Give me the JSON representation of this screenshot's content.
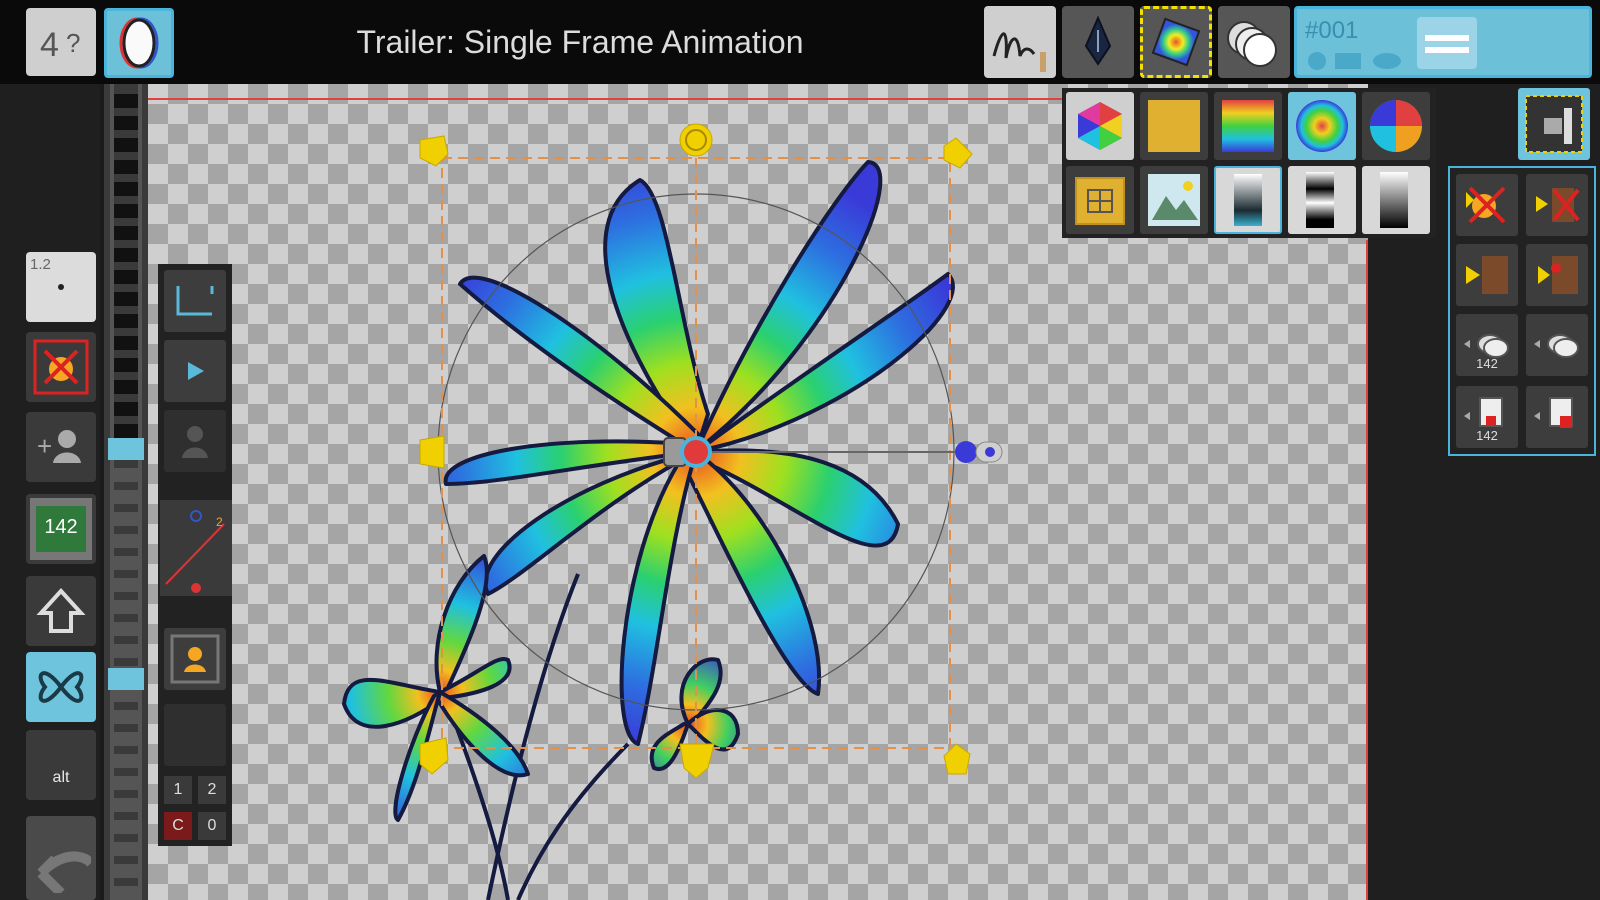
{
  "window": {
    "title": "Trailer: Single Frame Animation"
  },
  "toolbar_top": {
    "layer_label": "#001",
    "tools": [
      "brush-tool",
      "pen-tool",
      "fill-gradient-tool",
      "layers-tool"
    ]
  },
  "left_tools": {
    "zoom_value": "1.2",
    "frame_counter": "142",
    "alt_label": "alt"
  },
  "timeline_panel": {
    "keys": [
      "1",
      "2"
    ],
    "c_label": "C",
    "zero_label": "0"
  },
  "right_tools": {
    "count_a": "142",
    "count_b": "142"
  },
  "colors": {
    "accent": "#49b4dc",
    "selection": "#f2e000",
    "handle": "#f0d000",
    "guide_line": "#e0914a"
  }
}
